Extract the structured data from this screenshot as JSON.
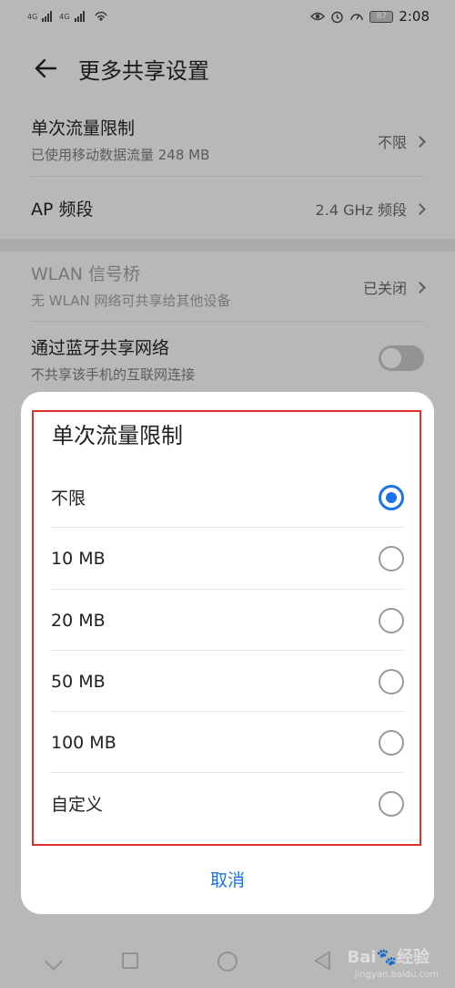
{
  "status": {
    "sim1": "4G",
    "sim2": "4G",
    "battery": "87",
    "time": "2:08"
  },
  "header": {
    "title": "更多共享设置"
  },
  "settings": {
    "data_limit": {
      "title": "单次流量限制",
      "subtitle": "已使用移动数据流量 248 MB",
      "value": "不限"
    },
    "ap_band": {
      "title": "AP 频段",
      "value": "2.4 GHz 频段"
    },
    "wlan_bridge": {
      "title": "WLAN 信号桥",
      "subtitle": "无 WLAN 网络可共享给其他设备",
      "value": "已关闭"
    },
    "bt_share": {
      "title": "通过蓝牙共享网络",
      "subtitle": "不共享该手机的互联网连接"
    }
  },
  "dialog": {
    "title": "单次流量限制",
    "options": [
      {
        "label": "不限",
        "selected": true
      },
      {
        "label": "10 MB",
        "selected": false
      },
      {
        "label": "20 MB",
        "selected": false
      },
      {
        "label": "50 MB",
        "selected": false
      },
      {
        "label": "100 MB",
        "selected": false
      },
      {
        "label": "自定义",
        "selected": false
      }
    ],
    "cancel_label": "取消"
  },
  "watermark": {
    "brand": "Bai🐾经验",
    "url": "jingyan.baidu.com"
  },
  "colors": {
    "accent": "#1a73e8",
    "highlight": "#e0302e"
  },
  "icons": {
    "back": "arrow-left-icon",
    "eye": "eye-icon",
    "alarm": "alarm-icon",
    "speedometer": "speedometer-icon"
  }
}
